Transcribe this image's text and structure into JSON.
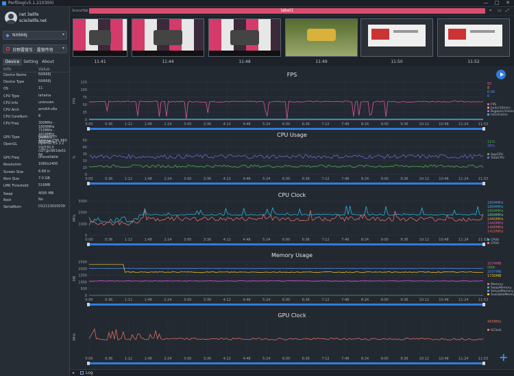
{
  "window": {
    "title": "PerfDog(v5.1.210300)",
    "controls": [
      "—",
      "□",
      "✕"
    ]
  },
  "user": {
    "name": "net 3elife",
    "email": "scie3elife.net"
  },
  "device_select": {
    "label": "NX666J"
  },
  "app_select": {
    "label": "日野露营车 · 露营传奇"
  },
  "sidebar_tabs": [
    {
      "label": "Device",
      "active": true
    },
    {
      "label": "Setting",
      "active": false
    },
    {
      "label": "About",
      "active": false
    }
  ],
  "info_table": {
    "col_info": "Info",
    "col_value": "Value",
    "rows": [
      {
        "k": "Device Name",
        "v": "NX666J"
      },
      {
        "k": "Device Type",
        "v": "NX666J"
      },
      {
        "k": "OS",
        "v": "11"
      },
      {
        "k": "CPU Type",
        "v": "lahaina"
      },
      {
        "k": "CPU Info",
        "v": "unknown"
      },
      {
        "k": "CPU Arch",
        "v": "arm64-v8a"
      },
      {
        "k": "CPU CoreNum",
        "v": "8"
      },
      {
        "k": "CPU Freq",
        "v": "300MHz - 1804MHz\n710MHz - 2419MHz\n844MHz - 2841MHz"
      },
      {
        "k": "GPU Type",
        "v": "Qualcomm Adreno (TM) 660"
      },
      {
        "k": "OpenGL",
        "v": "OpenGL ES 3.2 V@530.0\n(GIT@c961de51 66"
      },
      {
        "k": "GPU Freq",
        "v": "unavailable"
      },
      {
        "k": "Resolution",
        "v": "1080x2400"
      },
      {
        "k": "Screen Size",
        "v": "6.68 in"
      },
      {
        "k": "Rom Size",
        "v": "7.0 GB"
      },
      {
        "k": "LMK Threshold",
        "v": "516MB"
      },
      {
        "k": "Swap",
        "v": "4095 MB"
      },
      {
        "k": "Root",
        "v": "No"
      },
      {
        "k": "SerialNum",
        "v": "D12113010039"
      }
    ]
  },
  "scenebar": {
    "scene_label": "SceneTab",
    "label": "label1"
  },
  "thumbnails": [
    {
      "time": "11:41"
    },
    {
      "time": "11:44"
    },
    {
      "time": "11:48"
    },
    {
      "time": "11:49"
    },
    {
      "time": "11:50"
    },
    {
      "time": "11:52"
    }
  ],
  "icons": {
    "play": "play-icon",
    "location": "location-icon",
    "folder": "folder-icon",
    "expand": "expand-icon",
    "plus": "plus-icon"
  },
  "log": {
    "label": "Log"
  },
  "time_ticks": [
    "0:00",
    "0:36",
    "1:12",
    "1:48",
    "2:24",
    "3:00",
    "3:36",
    "4:12",
    "4:48",
    "5:24",
    "6:00",
    "6:36",
    "7:12",
    "7:48",
    "8:24",
    "9:00",
    "9:36",
    "10:12",
    "10:48",
    "11:24",
    "11:53"
  ],
  "chart_data": [
    {
      "type": "line",
      "title": "FPS",
      "ylabel": "FPS",
      "ylim": [
        0,
        125
      ],
      "yticks": [
        0,
        25,
        50,
        75,
        100,
        125
      ],
      "current": [
        "60",
        "8",
        "0.00",
        "0"
      ],
      "current_colors": [
        "#e0559e",
        "#e6a23c",
        "#6b8cff",
        "#26b5d8"
      ],
      "series": [
        {
          "name": "FPS",
          "color": "#e0559e",
          "base": 60,
          "noise": 2
        },
        {
          "name": "Jank(/10min)",
          "color": "#e6a23c",
          "base": 0,
          "noise": 0
        },
        {
          "name": "BigJank(/10min)",
          "color": "#8a6cf0",
          "base": 0,
          "noise": 0
        },
        {
          "name": "InterFrame",
          "color": "#26b5d8",
          "base": 2,
          "noise": 0
        }
      ]
    },
    {
      "type": "line",
      "title": "CPU Usage",
      "ylabel": "%",
      "ylim": [
        0,
        50
      ],
      "yticks": [
        0,
        10,
        20,
        30,
        40,
        50
      ],
      "current": [
        "11%",
        "26%"
      ],
      "current_colors": [
        "#4caf50",
        "#6b6bd6"
      ],
      "series": [
        {
          "name": "AppCPU",
          "color": "#4caf50",
          "base": 12,
          "noise": 2
        },
        {
          "name": "TotalCPU",
          "color": "#6b6bd6",
          "base": 26,
          "noise": 3
        }
      ]
    },
    {
      "type": "line",
      "title": "CPU Clock",
      "ylabel": "MHz",
      "ylim": [
        0,
        3000
      ],
      "yticks": [
        0,
        1000,
        2000,
        3000
      ],
      "current": [
        "1804MHz",
        "1804MHz",
        "1804MHz",
        "1804MHz",
        "1440MHz",
        "1440MHz",
        "1440MHz",
        "1420MHz"
      ],
      "current_colors": [
        "#6b8cff",
        "#26b5d8",
        "#4caf50",
        "#5fd0a8",
        "#e6a23c",
        "#e0559e",
        "#e07070",
        "#e05d5d"
      ],
      "series": [
        {
          "name": "CPU0",
          "color": "#26b5d8",
          "base": 1800,
          "noise": 60
        },
        {
          "name": "CPU4",
          "color": "#e07070",
          "base": 1420,
          "noise": 200
        }
      ]
    },
    {
      "type": "line",
      "title": "Memory Usage",
      "ylabel": "MB",
      "ylim": [
        0,
        2500
      ],
      "yticks": [
        0,
        500,
        1000,
        1500,
        2000,
        2500
      ],
      "current": [
        "1074MB",
        "0MB",
        "2007MB",
        "1730MB"
      ],
      "current_colors": [
        "#e0559e",
        "#4caf50",
        "#4a8fe7",
        "#e6c23c"
      ],
      "series": [
        {
          "name": "Memory",
          "color": "#d45adb",
          "base": 1074,
          "noise": 20
        },
        {
          "name": "SwapMemory",
          "color": "#4caf50",
          "base": 0,
          "noise": 0
        },
        {
          "name": "VirtualMemory",
          "color": "#4a8fe7",
          "base": 2007,
          "noise": 5
        },
        {
          "name": "AvailableMemory",
          "color": "#e6c23c",
          "base": 1730,
          "noise": 30
        }
      ]
    },
    {
      "type": "line",
      "title": "GPU Clock",
      "ylabel": "MHz",
      "ylim": [
        0,
        1000
      ],
      "yticks": [],
      "current": [
        "443MHz"
      ],
      "current_colors": [
        "#e07060"
      ],
      "series": [
        {
          "name": "GClock",
          "color": "#e07060",
          "base": 443,
          "noise": 30
        }
      ]
    }
  ]
}
